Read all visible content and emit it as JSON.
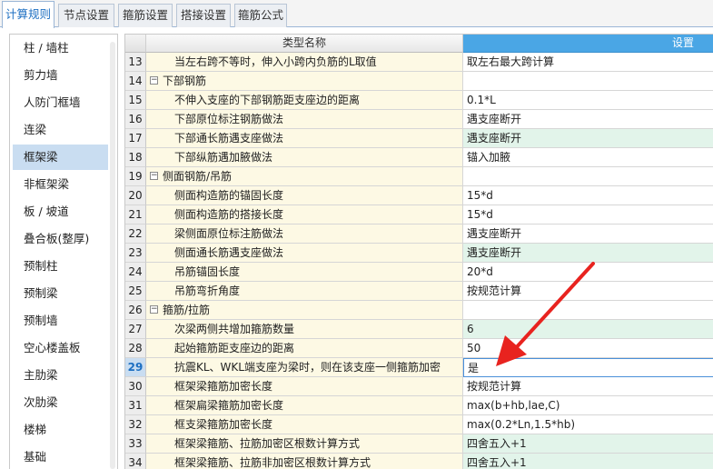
{
  "tabs": [
    {
      "label": "计算规则",
      "active": true
    },
    {
      "label": "节点设置",
      "active": false
    },
    {
      "label": "箍筋设置",
      "active": false
    },
    {
      "label": "搭接设置",
      "active": false
    },
    {
      "label": "箍筋公式",
      "active": false
    }
  ],
  "left_list": {
    "selected": "框架梁",
    "items": [
      "柱 / 墙柱",
      "剪力墙",
      "人防门框墙",
      "连梁",
      "框架梁",
      "非框架梁",
      "板 / 坡道",
      "叠合板(整厚)",
      "预制柱",
      "预制梁",
      "预制墙",
      "空心楼盖板",
      "主肋梁",
      "次肋梁",
      "楼梯",
      "基础"
    ]
  },
  "grid": {
    "headers": {
      "name": "类型名称",
      "setting": "设置"
    },
    "rows": [
      {
        "num": "13",
        "name": "当左右跨不等时，伸入小跨内负筋的L取值",
        "value": "取左右最大跨计算",
        "group": false,
        "green": false
      },
      {
        "num": "14",
        "name": "下部钢筋",
        "value": "",
        "group": true,
        "green": false
      },
      {
        "num": "15",
        "name": "不伸入支座的下部钢筋距支座边的距离",
        "value": "0.1*L",
        "group": false,
        "green": false
      },
      {
        "num": "16",
        "name": "下部原位标注钢筋做法",
        "value": "遇支座断开",
        "group": false,
        "green": false
      },
      {
        "num": "17",
        "name": "下部通长筋遇支座做法",
        "value": "遇支座断开",
        "group": false,
        "green": true
      },
      {
        "num": "18",
        "name": "下部纵筋遇加腋做法",
        "value": "锚入加腋",
        "group": false,
        "green": false
      },
      {
        "num": "19",
        "name": "侧面钢筋/吊筋",
        "value": "",
        "group": true,
        "green": false
      },
      {
        "num": "20",
        "name": "侧面构造筋的锚固长度",
        "value": "15*d",
        "group": false,
        "green": false
      },
      {
        "num": "21",
        "name": "侧面构造筋的搭接长度",
        "value": "15*d",
        "group": false,
        "green": false
      },
      {
        "num": "22",
        "name": "梁侧面原位标注筋做法",
        "value": "遇支座断开",
        "group": false,
        "green": false
      },
      {
        "num": "23",
        "name": "侧面通长筋遇支座做法",
        "value": "遇支座断开",
        "group": false,
        "green": true
      },
      {
        "num": "24",
        "name": "吊筋锚固长度",
        "value": "20*d",
        "group": false,
        "green": false
      },
      {
        "num": "25",
        "name": "吊筋弯折角度",
        "value": "按规范计算",
        "group": false,
        "green": false
      },
      {
        "num": "26",
        "name": "箍筋/拉筋",
        "value": "",
        "group": true,
        "green": false
      },
      {
        "num": "27",
        "name": "次梁两侧共增加箍筋数量",
        "value": "6",
        "group": false,
        "green": true
      },
      {
        "num": "28",
        "name": "起始箍筋距支座边的距离",
        "value": "50",
        "group": false,
        "green": false
      },
      {
        "num": "29",
        "name": "抗震KL、WKL端支座为梁时，则在该支座一侧箍筋加密",
        "value": "是",
        "group": false,
        "green": false,
        "selected": true
      },
      {
        "num": "30",
        "name": "框架梁箍筋加密长度",
        "value": "按规范计算",
        "group": false,
        "green": false
      },
      {
        "num": "31",
        "name": "框架扁梁箍筋加密长度",
        "value": "max(b+hb,lae,C)",
        "group": false,
        "green": false
      },
      {
        "num": "32",
        "name": "框支梁箍筋加密长度",
        "value": "max(0.2*Ln,1.5*hb)",
        "group": false,
        "green": false
      },
      {
        "num": "33",
        "name": "框架梁箍筋、拉筋加密区根数计算方式",
        "value": "四舍五入+1",
        "group": false,
        "green": true
      },
      {
        "num": "34",
        "name": "框架梁箍筋、拉筋非加密区根数计算方式",
        "value": "四舍五入+1",
        "group": false,
        "green": true
      }
    ]
  },
  "colors": {
    "accent": "#4aa6e5",
    "name_bg": "#fdf9e4",
    "value_green": "#e2f4ea",
    "selected_bg": "#c9ddf1",
    "arrow": "#e8231f"
  }
}
